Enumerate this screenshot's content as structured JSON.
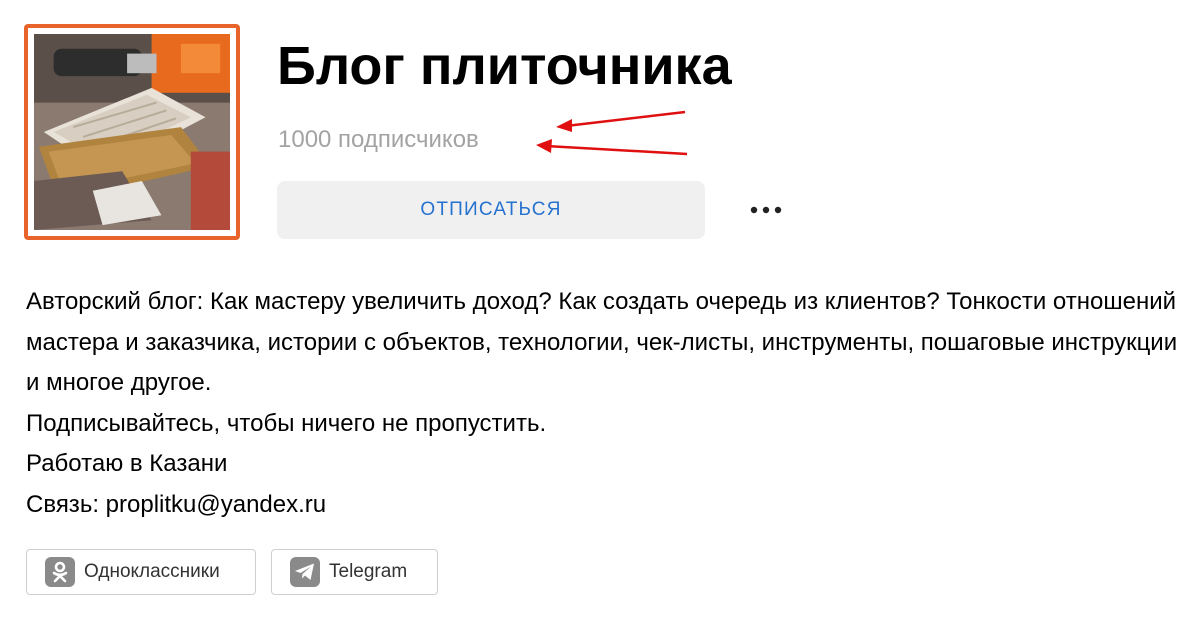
{
  "channel": {
    "title": "Блог плиточника",
    "subscribers": "1000 подписчиков",
    "avatar_alt": "tile-cutter-photo"
  },
  "actions": {
    "unsubscribe_label": "ОТПИСАТЬСЯ",
    "more_icon": "more-dots-icon"
  },
  "description": {
    "paragraph": "Авторский блог: Как мастеру увеличить доход? Как создать очередь из клиентов? Тонкости отношений мастера и заказчика, истории с объектов, технологии, чек-листы, инструменты, пошаговые инструкции и многое другое.",
    "line_subscribe": "Подписывайтесь, чтобы ничего не пропустить.",
    "line_location": "Работаю в Казани",
    "line_contact": "Связь: proplitku@yandex.ru"
  },
  "social_links": [
    {
      "label": "Одноклассники",
      "icon": "odnoklassniki-icon"
    },
    {
      "label": "Telegram",
      "icon": "telegram-icon"
    }
  ],
  "colors": {
    "avatar_border": "#e8642a",
    "button_text": "#2672cf",
    "button_background": "#f0f0f0",
    "muted_text": "#a3a3a3",
    "annotation_arrows": "#e01010"
  }
}
